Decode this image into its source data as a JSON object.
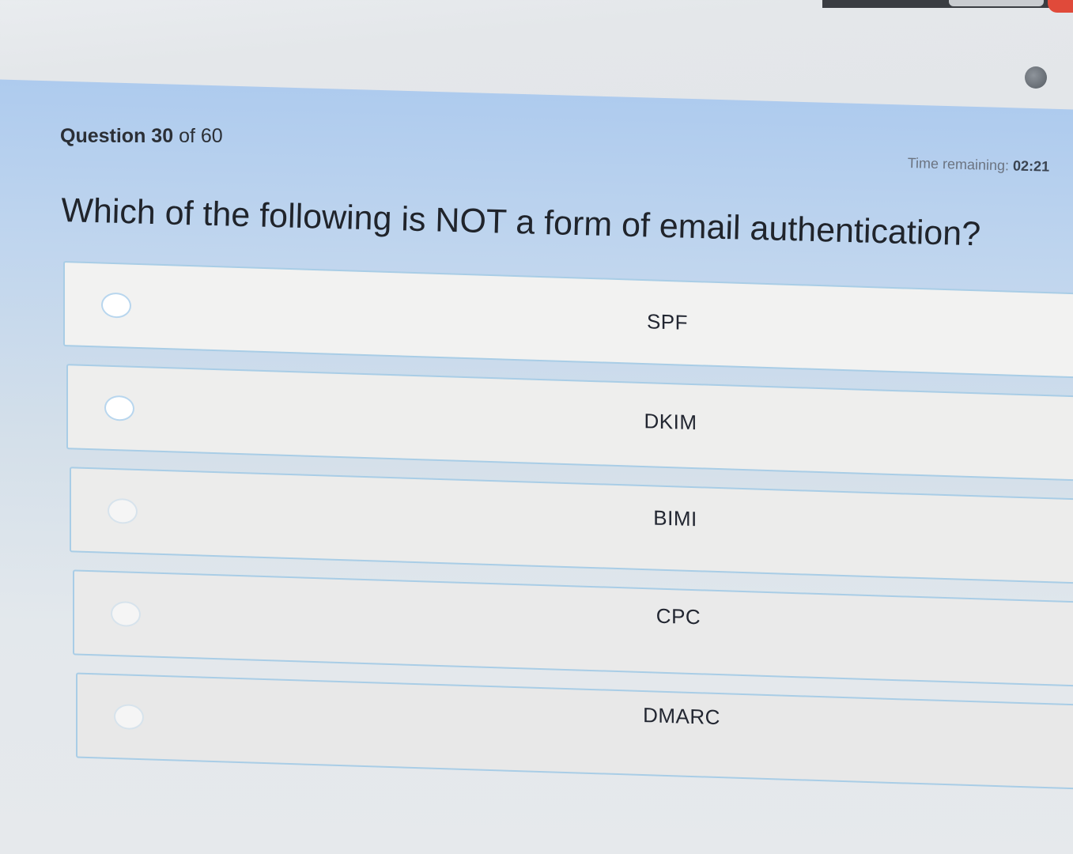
{
  "quiz": {
    "question_word": "Question",
    "current": "30",
    "of_total": "of 60",
    "timer_label": "Time remaining:",
    "timer_value": "02:21",
    "question": "Which of the following is NOT a form of email authentication?",
    "options": [
      {
        "label": "SPF"
      },
      {
        "label": "DKIM"
      },
      {
        "label": "BIMI"
      },
      {
        "label": "CPC"
      },
      {
        "label": "DMARC"
      }
    ]
  },
  "colors": {
    "header_blue": "#aecbee",
    "option_border": "#a9cde6",
    "text": "#20242b"
  }
}
